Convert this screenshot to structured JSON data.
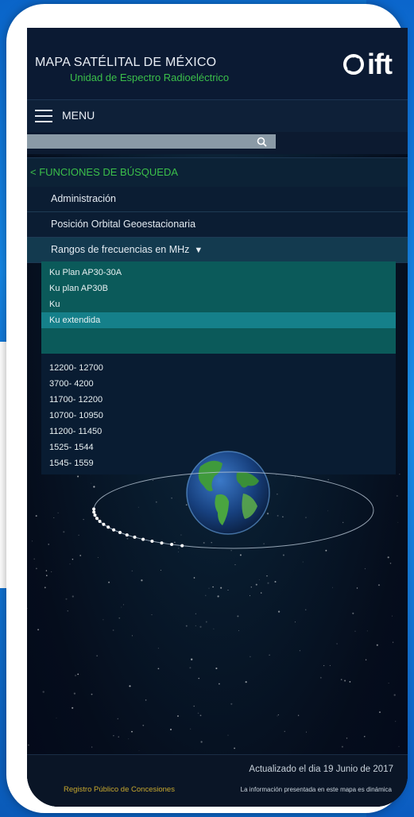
{
  "header": {
    "title": "MAPA SATÉLITAL DE MÉXICO",
    "subtitle": "Unidad de Espectro Radioeléctrico",
    "logo_text": "ift"
  },
  "menu": {
    "label": "MENU",
    "icon": "hamburger-icon"
  },
  "search": {
    "value": "",
    "placeholder": "",
    "icon": "search-icon"
  },
  "search_functions": {
    "label": "< FUNCIONES DE BÚSQUEDA",
    "items": [
      {
        "label": "Administración"
      },
      {
        "label": "Posición Orbital Geoestacionaria"
      },
      {
        "label": "Rangos de frecuencias en MHz",
        "expanded": true
      }
    ]
  },
  "dropdown": {
    "plans": [
      {
        "label": "Ku Plan AP30-30A"
      },
      {
        "label": "Ku plan AP30B"
      },
      {
        "label": "Ku"
      },
      {
        "label": "Ku extendida",
        "selected": true
      }
    ],
    "ranges": [
      {
        "label": "12200- 12700"
      },
      {
        "label": "3700- 4200"
      },
      {
        "label": "11700- 12200"
      },
      {
        "label": "10700- 10950"
      },
      {
        "label": "11200- 11450"
      },
      {
        "label": "1525- 1544"
      },
      {
        "label": "1545- 1559"
      }
    ]
  },
  "footer": {
    "updated": "Actualizado  el dia 19  Junio de 2017",
    "registry_link": "Registro Público de Concesiones",
    "note": "La información presentada en este mapa es dinámica"
  },
  "colors": {
    "accent_green": "#3bbf4a",
    "highlight_teal": "#15808a",
    "registry_gold": "#c7a82e"
  }
}
